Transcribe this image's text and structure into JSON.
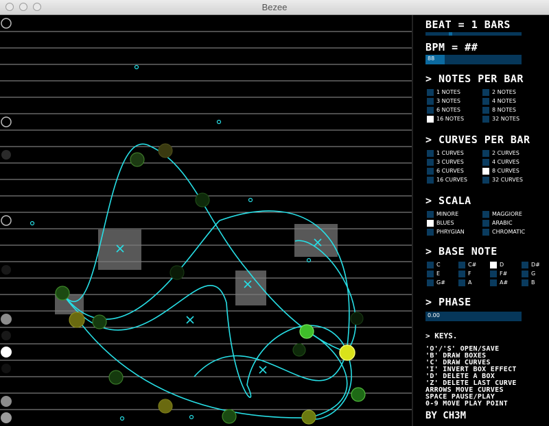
{
  "window": {
    "title": "Bezee"
  },
  "panel": {
    "beat_label": "BEAT = 1 BARS",
    "bpm_label": "BPM = ##",
    "bpm_value": "88",
    "bpm_fraction": 0.2,
    "beat_indicator_fraction": 0.24,
    "notes_header": "> NOTES PER BAR",
    "notes_options": [
      {
        "label": "1 NOTES",
        "on": false
      },
      {
        "label": "2 NOTES",
        "on": false
      },
      {
        "label": "3 NOTES",
        "on": false
      },
      {
        "label": "4 NOTES",
        "on": false
      },
      {
        "label": "6 NOTES",
        "on": false
      },
      {
        "label": "8 NOTES",
        "on": false
      },
      {
        "label": "16 NOTES",
        "on": true
      },
      {
        "label": "32 NOTES",
        "on": false
      }
    ],
    "curves_header": "> CURVES PER BAR",
    "curves_options": [
      {
        "label": "1 CURVES",
        "on": false
      },
      {
        "label": "2 CURVES",
        "on": false
      },
      {
        "label": "3 CURVES",
        "on": false
      },
      {
        "label": "4 CURVES",
        "on": false
      },
      {
        "label": "6 CURVES",
        "on": false
      },
      {
        "label": "8 CURVES",
        "on": true
      },
      {
        "label": "16 CURVES",
        "on": false
      },
      {
        "label": "32 CURVES",
        "on": false
      }
    ],
    "scala_header": "> SCALA",
    "scala_options": [
      {
        "label": "MINORE",
        "on": false
      },
      {
        "label": "MAGGIORE",
        "on": false
      },
      {
        "label": "BLUES",
        "on": true
      },
      {
        "label": "ARABIC",
        "on": false
      },
      {
        "label": "PHRYGIAN",
        "on": false
      },
      {
        "label": "CHROMATIC",
        "on": false
      }
    ],
    "base_note_header": "> BASE NOTE",
    "base_note_options": [
      {
        "label": "C",
        "on": false
      },
      {
        "label": "C#",
        "on": false
      },
      {
        "label": "D",
        "on": true
      },
      {
        "label": "D#",
        "on": false
      },
      {
        "label": "E",
        "on": false
      },
      {
        "label": "F",
        "on": false
      },
      {
        "label": "F#",
        "on": false
      },
      {
        "label": "G",
        "on": false
      },
      {
        "label": "G#",
        "on": false
      },
      {
        "label": "A",
        "on": false
      },
      {
        "label": "A#",
        "on": false
      },
      {
        "label": "B",
        "on": false
      }
    ],
    "phase_header": "> PHASE",
    "phase_value": "0.00",
    "keys_title": "> KEYS.",
    "keys_lines": [
      "'O'/'S' OPEN/SAVE",
      "'B' DRAW BOXES",
      "'C' DRAW CURVES",
      "'I' INVERT BOX EFFECT",
      "'D' DELETE A BOX",
      "'Z' DELETE LAST CURVE",
      "ARROWS MOVE CURVES",
      "SPACE PAUSE/PLAY",
      "0-9 MOVE PLAY POINT"
    ],
    "credit": "BY CH3M"
  },
  "colors": {
    "curve": "#27dfe6",
    "box": "#7a7a7a",
    "selector": "#0a3b5e",
    "bar_fill": "#0b6aa0"
  }
}
